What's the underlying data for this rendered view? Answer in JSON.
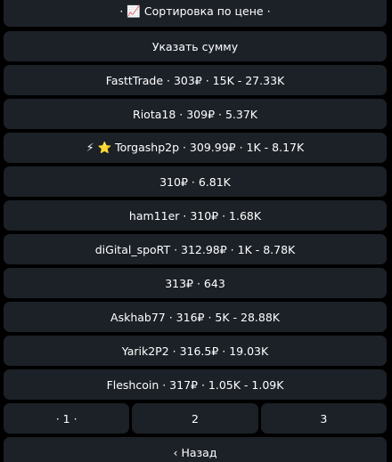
{
  "keyboard": {
    "header_label": "· 📈 Сортировка по цене ·",
    "specify_amount_label": "Указать сумму",
    "offers": [
      "FasttTrade · 303₽ · 15K - 27.33K",
      "Riota18 · 309₽ · 5.37K",
      "⚡ ⭐ Torgashp2p · 309.99₽ · 1K - 8.17K",
      "310₽ · 6.81K",
      "ham11er · 310₽ · 1.68K",
      "diGital_spoRT · 312.98₽ · 1K - 8.78K",
      "313₽ · 643",
      "Askhab77 · 316₽ · 5K - 28.88K",
      "Yarik2P2 · 316.5₽ · 19.03K",
      "Fleshcoin · 317₽ · 1.05K - 1.09K"
    ],
    "pages": [
      "· 1 ·",
      "2",
      "3"
    ],
    "back_label": "‹ Назад"
  },
  "colors": {
    "background": "#000000",
    "button_bg": "#1c2128",
    "text": "#ffffff"
  }
}
